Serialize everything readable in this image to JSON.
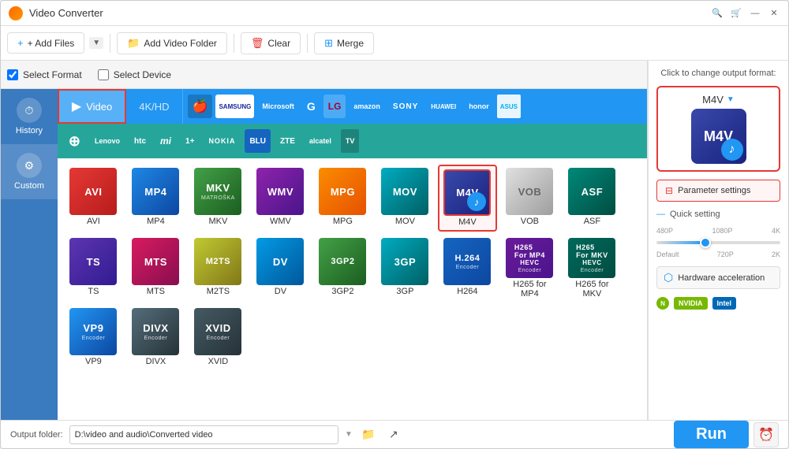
{
  "titleBar": {
    "icon": "🎬",
    "title": "Video Converter",
    "controls": [
      "search",
      "cart",
      "minimize",
      "close"
    ]
  },
  "toolbar": {
    "addFiles": "+ Add Files",
    "addVideoFolder": "Add Video Folder",
    "clear": "Clear",
    "merge": "Merge"
  },
  "formatBar": {
    "selectFormat": "Select Format",
    "selectDevice": "Select Device"
  },
  "sidebar": {
    "history": "History",
    "custom": "Custom"
  },
  "tabs": [
    {
      "id": "video",
      "label": "Video",
      "icon": "▶",
      "active": true
    },
    {
      "id": "4k",
      "label": "4K/HD",
      "active": false
    },
    {
      "id": "apple",
      "label": "",
      "brand": "apple"
    },
    {
      "id": "samsung",
      "label": "SAMSUNG"
    },
    {
      "id": "microsoft",
      "label": "Microsoft"
    },
    {
      "id": "google",
      "label": "G"
    },
    {
      "id": "lg",
      "label": "LG"
    },
    {
      "id": "amazon",
      "label": "amazon"
    },
    {
      "id": "sony",
      "label": "SONY"
    },
    {
      "id": "huawei",
      "label": "HUAWEI"
    },
    {
      "id": "honor",
      "label": "honor"
    },
    {
      "id": "asus",
      "label": "ASUS"
    }
  ],
  "tabs2": [
    {
      "id": "moto",
      "label": "⊕"
    },
    {
      "id": "lenovo",
      "label": "Lenovo"
    },
    {
      "id": "htc",
      "label": "htc"
    },
    {
      "id": "mi",
      "label": "mi"
    },
    {
      "id": "plus",
      "label": "1+"
    },
    {
      "id": "nokia",
      "label": "NOKIA"
    },
    {
      "id": "blu",
      "label": "BLU"
    },
    {
      "id": "zte",
      "label": "ZTE"
    },
    {
      "id": "alcatel",
      "label": "alcatel"
    },
    {
      "id": "tv",
      "label": "TV"
    }
  ],
  "formats": [
    {
      "id": "avi",
      "label": "AVI",
      "cls": "fmt-avi"
    },
    {
      "id": "mp4",
      "label": "MP4",
      "cls": "fmt-mp4"
    },
    {
      "id": "mkv",
      "label": "MKV",
      "cls": "fmt-mkv",
      "sub": "MATROSKA"
    },
    {
      "id": "wmv",
      "label": "WMV",
      "cls": "fmt-wmv"
    },
    {
      "id": "mpg",
      "label": "MPG",
      "cls": "fmt-mpg"
    },
    {
      "id": "mov",
      "label": "MOV",
      "cls": "fmt-mov"
    },
    {
      "id": "m4v",
      "label": "M4V",
      "cls": "fmt-m4v",
      "selected": true
    },
    {
      "id": "vob",
      "label": "VOB",
      "cls": "fmt-vob"
    },
    {
      "id": "asf",
      "label": "ASF",
      "cls": "fmt-asf"
    },
    {
      "id": "ts",
      "label": "TS",
      "cls": "fmt-ts"
    },
    {
      "id": "mts",
      "label": "MTS",
      "cls": "fmt-mts"
    },
    {
      "id": "m2ts",
      "label": "M2TS",
      "cls": "fmt-m2ts"
    },
    {
      "id": "dv",
      "label": "DV",
      "cls": "fmt-dv"
    },
    {
      "id": "3gp2",
      "label": "3GP2",
      "cls": "fmt-3gp2"
    },
    {
      "id": "3gp",
      "label": "3GP",
      "cls": "fmt-3gp"
    },
    {
      "id": "h264",
      "label": "H.264",
      "cls": "fmt-h264"
    },
    {
      "id": "h265mp4",
      "label": "H265 for MP4",
      "cls": "fmt-h265mp4",
      "sub": "HEVC"
    },
    {
      "id": "h265mkv",
      "label": "H265 for MKV",
      "cls": "fmt-h265mkv",
      "sub": "HEVC"
    },
    {
      "id": "vp9",
      "label": "VP9",
      "cls": "fmt-vp9"
    },
    {
      "id": "divx",
      "label": "DIVX",
      "cls": "fmt-divx"
    },
    {
      "id": "xvid",
      "label": "XVID",
      "cls": "fmt-xvid"
    }
  ],
  "rightPanel": {
    "clickToChange": "Click to change output format:",
    "formatName": "M4V",
    "paramSettings": "Parameter settings",
    "quickSetting": "Quick setting",
    "qualityLabelsTop": [
      "480P",
      "1080P",
      "4K"
    ],
    "qualityLabelsBottom": [
      "Default",
      "720P",
      "2K"
    ],
    "hwAcceleration": "Hardware acceleration",
    "nvidia": "NVIDIA",
    "intel": "Intel"
  },
  "bottomBar": {
    "outputFolderLabel": "Output folder:",
    "outputPath": "D:\\video and audio\\Converted video",
    "runLabel": "Run"
  }
}
